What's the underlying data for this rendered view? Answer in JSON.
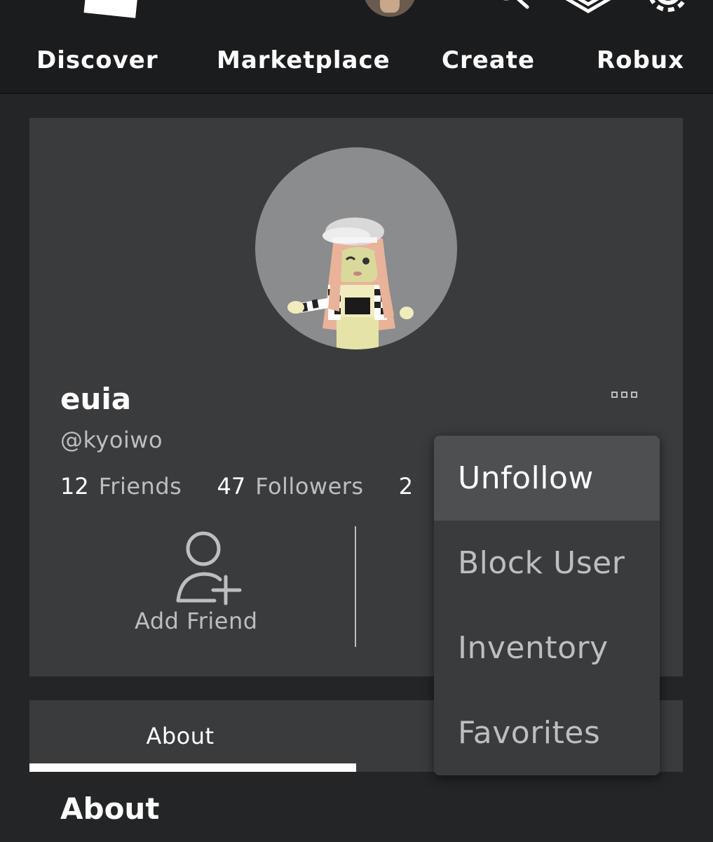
{
  "nav": {
    "items": [
      {
        "label": "Discover"
      },
      {
        "label": "Marketplace"
      },
      {
        "label": "Create"
      },
      {
        "label": "Robux"
      }
    ]
  },
  "header_icons": [
    "roblox-logo-icon",
    "user-avatar-icon",
    "search-icon",
    "robux-icon",
    "gear-icon"
  ],
  "profile": {
    "display_name": "euia",
    "username": "@kyoiwo",
    "stats": [
      {
        "count": "12",
        "label": "Friends"
      },
      {
        "count": "47",
        "label": "Followers"
      },
      {
        "count": "2",
        "label": ""
      }
    ],
    "add_friend_label": "Add Friend"
  },
  "menu": {
    "items": [
      {
        "label": "Unfollow"
      },
      {
        "label": "Block User"
      },
      {
        "label": "Inventory"
      },
      {
        "label": "Favorites"
      }
    ]
  },
  "tabs": [
    {
      "label": "About"
    }
  ],
  "section": {
    "title": "About"
  },
  "colors": {
    "page_bg": "#232527",
    "header_bg": "#1b1c1e",
    "card_bg": "#393b3d",
    "muted_text": "#bdbebe",
    "menu_highlight": "#4d4f51"
  }
}
